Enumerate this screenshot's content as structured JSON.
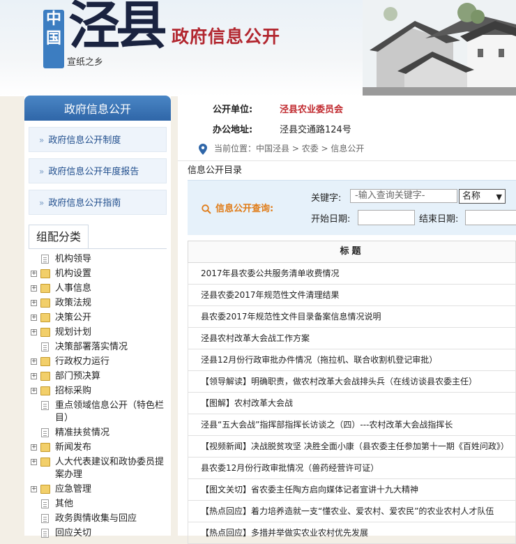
{
  "banner": {
    "logo_country": "中国",
    "logo_name": "泾县",
    "logo_slogan": "宣纸之乡",
    "title": "政府信息公开"
  },
  "sidebar": {
    "header": "政府信息公开",
    "links": [
      {
        "label": "政府信息公开制度"
      },
      {
        "label": "政府信息公开年度报告"
      },
      {
        "label": "政府信息公开指南"
      }
    ],
    "category_title": "组配分类",
    "tree": [
      {
        "label": "机构领导",
        "type": "doc"
      },
      {
        "label": "机构设置",
        "type": "folder"
      },
      {
        "label": "人事信息",
        "type": "folder"
      },
      {
        "label": "政策法规",
        "type": "folder"
      },
      {
        "label": "决策公开",
        "type": "folder"
      },
      {
        "label": "规划计划",
        "type": "folder"
      },
      {
        "label": "决策部署落实情况",
        "type": "doc"
      },
      {
        "label": "行政权力运行",
        "type": "folder"
      },
      {
        "label": "部门预决算",
        "type": "folder"
      },
      {
        "label": "招标采购",
        "type": "folder"
      },
      {
        "label": "重点领域信息公开（特色栏目）",
        "type": "doc"
      },
      {
        "label": "精准扶贫情况",
        "type": "doc"
      },
      {
        "label": "新闻发布",
        "type": "folder"
      },
      {
        "label": "人大代表建议和政协委员提案办理",
        "type": "folder"
      },
      {
        "label": "应急管理",
        "type": "folder"
      },
      {
        "label": "其他",
        "type": "doc"
      },
      {
        "label": "政务舆情收集与回应",
        "type": "doc"
      },
      {
        "label": "回应关切",
        "type": "doc"
      }
    ]
  },
  "info": {
    "unit_label": "公开单位:",
    "unit_value": "泾县农业委员会",
    "address_label": "办公地址:",
    "address_value": "泾县交通路124号"
  },
  "breadcrumb": {
    "prefix": "当前位置：",
    "path": "中国泾县 > 农委 > 信息公开"
  },
  "directory_title": "信息公开目录",
  "query": {
    "label": "信息公开查询:",
    "keyword_label": "关键字:",
    "keyword_placeholder": "-输入查询关键字-",
    "select_value": "名称",
    "start_label": "开始日期:",
    "end_label": "结束日期:"
  },
  "table": {
    "header": "标题",
    "rows": [
      "2017年县农委公共服务清单收费情况",
      "泾县农委2017年规范性文件清理结果",
      "县农委2017年规范性文件目录备案信息情况说明",
      "泾县农村改革大会战工作方案",
      "泾县12月份行政审批办件情况（拖拉机、联合收割机登记审批）",
      "【领导解读】明确职责，做农村改革大会战排头兵（在线访谈县农委主任）",
      "【图解】农村改革大会战",
      "泾县“五大会战”指挥部指挥长访谈之（四）---农村改革大会战指挥长",
      "【视频新闻】决战脱贫攻坚 决胜全面小康（县农委主任参加第十一期《百姓问政》）",
      "县农委12月份行政审批情况（兽药经营许可证）",
      "【图文关切】省农委主任陶方启向媒体记者宣讲十九大精神",
      "【热点回应】着力培养造就一支“懂农业、爱农村、爱农民”的农业农村人才队伍",
      "【热点回应】多措并举做实农业农村优先发展"
    ]
  },
  "colors": {
    "brand_blue": "#2f66a8",
    "title_red": "#b2262f",
    "query_orange": "#e07b16"
  }
}
